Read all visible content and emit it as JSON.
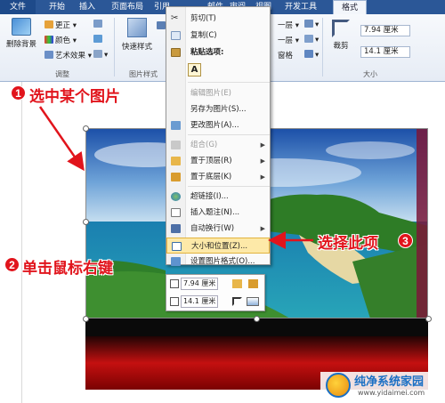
{
  "ribbon": {
    "tabs": [
      {
        "label": "文件"
      },
      {
        "label": "开始"
      },
      {
        "label": "插入"
      },
      {
        "label": "页面布局"
      },
      {
        "label": "引用"
      },
      {
        "label": "邮件"
      },
      {
        "label": "审阅"
      },
      {
        "label": "视图"
      },
      {
        "label": "开发工具"
      },
      {
        "label": "格式"
      }
    ],
    "active_tab": "格式",
    "adjust_group": {
      "remove_bg": "删除背景",
      "corrections": "更正",
      "color": "颜色",
      "artistic": "艺术效果",
      "label": "调整"
    },
    "styles_group": {
      "quick_styles": "快速样式",
      "label": "图片样式"
    },
    "arrange_group": {
      "row1": "一层",
      "row2": "一层",
      "row3": "窗格"
    },
    "size_group": {
      "crop": "裁剪",
      "height": "7.94 厘米",
      "width": "14.1 厘米",
      "label": "大小"
    }
  },
  "context_menu": {
    "items": [
      {
        "label": "剪切(T)",
        "disabled": false
      },
      {
        "label": "复制(C)",
        "disabled": false
      },
      {
        "label": "粘贴选项:",
        "disabled": false
      },
      {
        "label": "编辑图片(E)",
        "disabled": true
      },
      {
        "label": "另存为图片(S)...",
        "disabled": false
      },
      {
        "label": "更改图片(A)...",
        "disabled": false
      },
      {
        "label": "组合(G)",
        "disabled": true
      },
      {
        "label": "置于顶层(R)",
        "disabled": false
      },
      {
        "label": "置于底层(K)",
        "disabled": false
      },
      {
        "label": "超链接(I)...",
        "disabled": false
      },
      {
        "label": "插入题注(N)...",
        "disabled": false
      },
      {
        "label": "自动换行(W)",
        "disabled": false
      },
      {
        "label": "大小和位置(Z)...",
        "disabled": false
      },
      {
        "label": "设置图片格式(O)...",
        "disabled": false
      }
    ],
    "paste_option": "A"
  },
  "mini_toolbar": {
    "height": "7.94 厘米",
    "width": "14.1 厘米"
  },
  "annotations": {
    "step1": {
      "num": "1",
      "text": "选中某个图片"
    },
    "step2": {
      "num": "2",
      "text": "单击鼠标右键"
    },
    "step3": {
      "num": "3",
      "text": "选择此项"
    }
  },
  "watermark": {
    "title": "纯净系统家园",
    "url": "www.yidaimei.com"
  },
  "colors": {
    "tabbar": "#2b5797",
    "annotation_red": "#e1141c",
    "highlight": "#fde9a8"
  }
}
